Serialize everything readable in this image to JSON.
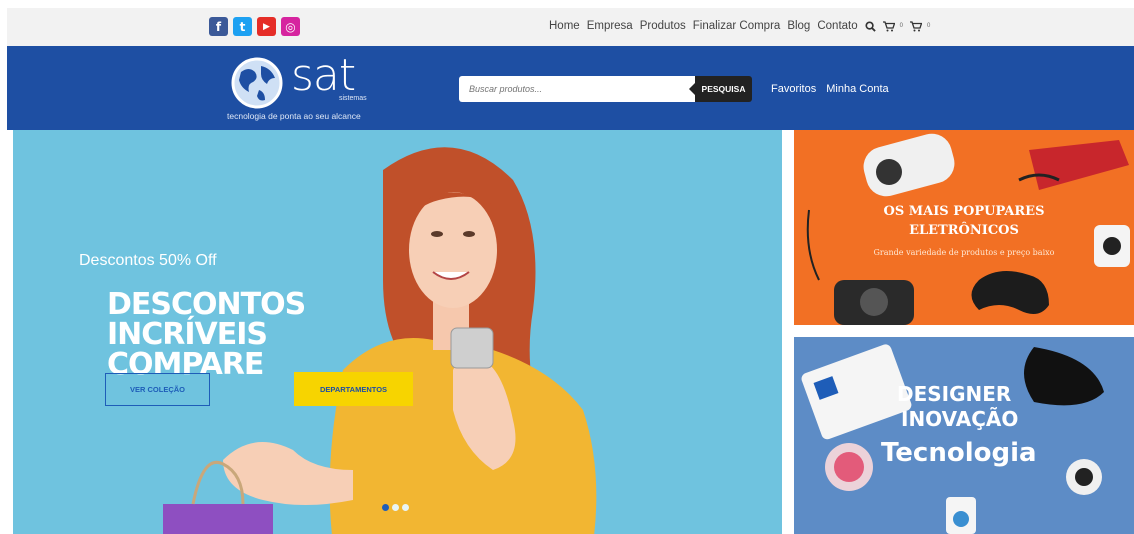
{
  "social": [
    {
      "name": "facebook",
      "glyph": "f",
      "color": "#3b5998"
    },
    {
      "name": "twitter",
      "glyph": "t",
      "color": "#1da1f2"
    },
    {
      "name": "youtube",
      "glyph": "▶",
      "color": "#e52d27"
    },
    {
      "name": "instagram",
      "glyph": "◎",
      "color": "#d6249f"
    }
  ],
  "nav": {
    "items": [
      "Home",
      "Empresa",
      "Produtos",
      "Finalizar Compra",
      "Blog",
      "Contato"
    ],
    "cart1_count": "0",
    "cart2_count": "0"
  },
  "logo": {
    "brand": "sat",
    "sub": "sistemas",
    "tagline": "tecnologia de ponta ao seu alcance"
  },
  "search": {
    "placeholder": "Buscar produtos...",
    "button": "PESQUISA"
  },
  "header_links": [
    "Favoritos",
    "Minha Conta"
  ],
  "hero": {
    "subtitle": "Descontos 50% Off",
    "title_line1": "DESCONTOS INCRÍVEIS",
    "title_line2": "COMPARE",
    "btn_outline": "VER COLEÇÃO",
    "btn_yellow": "DEPARTAMENTOS",
    "slides": 3,
    "active_slide": 1
  },
  "banner1": {
    "line1": "OS MAIS POPUPARES",
    "line2": "ELETRÔNICOS",
    "line3": "Grande variedade de produtos e preço baixo"
  },
  "banner2": {
    "line1": "DESIGNER",
    "line2": "INOVAÇÃO",
    "line3": "Tecnologia"
  },
  "colors": {
    "header": "#1e4fa3",
    "topbar": "#f2f2f2",
    "hero_bg": "#6fc3df",
    "accent_yellow": "#f7d400",
    "banner_orange": "#f27024",
    "banner_blue": "#5d8cc6"
  }
}
